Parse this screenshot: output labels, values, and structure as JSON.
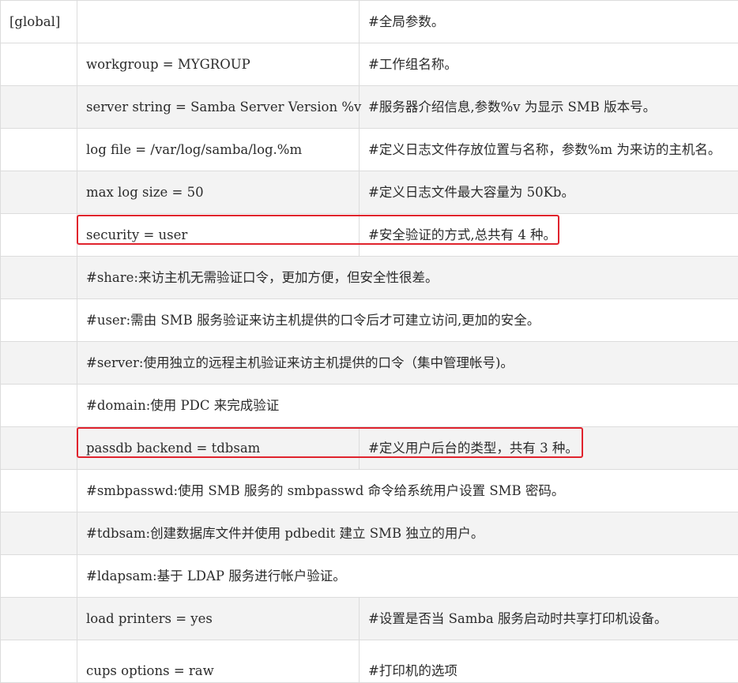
{
  "rows": [
    {
      "c1": "[global]",
      "c2": "",
      "c3": "#全局参数。"
    },
    {
      "c1": "",
      "c2": "workgroup = MYGROUP",
      "c3": "#工作组名称。"
    },
    {
      "c1": "",
      "c2": "server string = Samba Server Version %v",
      "c3": "#服务器介绍信息,参数%v 为显示 SMB 版本号。"
    },
    {
      "c1": "",
      "c2": "log file = /var/log/samba/log.%m",
      "c3": "#定义日志文件存放位置与名称，参数%m 为来访的主机名。"
    },
    {
      "c1": "",
      "c2": "max log size = 50",
      "c3": "#定义日志文件最大容量为 50Kb。"
    },
    {
      "c1": "",
      "c2": "security = user",
      "c3": "#安全验证的方式,总共有 4 种。"
    },
    {
      "c1": "",
      "span": "#share:来访主机无需验证口令，更加方便，但安全性很差。"
    },
    {
      "c1": "",
      "span": "#user:需由 SMB 服务验证来访主机提供的口令后才可建立访问,更加的安全。"
    },
    {
      "c1": "",
      "span": "#server:使用独立的远程主机验证来访主机提供的口令（集中管理帐号)。"
    },
    {
      "c1": "",
      "span": "#domain:使用 PDC 来完成验证"
    },
    {
      "c1": "",
      "c2": "passdb backend = tdbsam",
      "c3": "#定义用户后台的类型，共有 3 种。"
    },
    {
      "c1": "",
      "span": "#smbpasswd:使用 SMB 服务的 smbpasswd 命令给系统用户设置 SMB 密码。"
    },
    {
      "c1": "",
      "span": "#tdbsam:创建数据库文件并使用 pdbedit 建立 SMB 独立的用户。"
    },
    {
      "c1": "",
      "span": "#ldapsam:基于 LDAP 服务进行帐户验证。"
    },
    {
      "c1": "",
      "c2": "load printers = yes",
      "c3": "#设置是否当 Samba 服务启动时共享打印机设备。"
    },
    {
      "c1": "",
      "c2": "cups options = raw",
      "c3": "#打印机的选项"
    }
  ],
  "highlights": [
    {
      "row": 5,
      "color": "#e0232d"
    },
    {
      "row": 10,
      "color": "#e0232d"
    }
  ]
}
